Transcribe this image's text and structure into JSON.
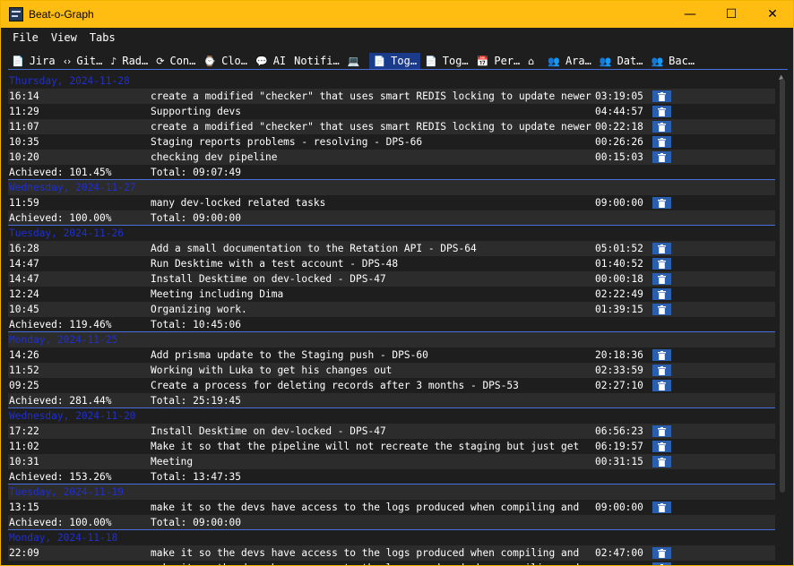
{
  "window": {
    "title": "Beat-o-Graph",
    "controls": [
      "—",
      "☐",
      "✕"
    ]
  },
  "menu": [
    "File",
    "View",
    "Tabs"
  ],
  "tabs": [
    {
      "icon": "📄",
      "label": "Jira"
    },
    {
      "icon": "‹›",
      "label": "Git…"
    },
    {
      "icon": "♪",
      "label": "Rad…"
    },
    {
      "icon": "⟳",
      "label": "Con…"
    },
    {
      "icon": "⌚",
      "label": "Clo…"
    },
    {
      "icon": "💬",
      "label": "AI"
    },
    {
      "icon": "",
      "label": "Notifi…"
    },
    {
      "icon": "💻",
      "label": ""
    },
    {
      "icon": "📄",
      "label": "Tog…",
      "active": true
    },
    {
      "icon": "📄",
      "label": "Tog…"
    },
    {
      "icon": "📅",
      "label": "Per…"
    },
    {
      "icon": "⌂",
      "label": ""
    },
    {
      "icon": "👥",
      "label": "Ara…"
    },
    {
      "icon": "👥",
      "label": "Dat…"
    },
    {
      "icon": "👥",
      "label": "Bac…"
    }
  ],
  "days": [
    {
      "header": "Thursday, 2024-11-28",
      "entries": [
        {
          "time": "16:14",
          "desc": "create a modified \"checker\" that uses smart REDIS locking to update newer",
          "dur": "03:19:05"
        },
        {
          "time": "11:29",
          "desc": "Supporting devs",
          "dur": "04:44:57"
        },
        {
          "time": "11:07",
          "desc": "create a modified \"checker\" that uses smart REDIS locking to update newer",
          "dur": "00:22:18"
        },
        {
          "time": "10:35",
          "desc": "Staging reports problems - resolving - DPS-66",
          "dur": "00:26:26"
        },
        {
          "time": "10:20",
          "desc": "checking dev pipeline",
          "dur": "00:15:03"
        }
      ],
      "achieved": "Achieved: 101.45%",
      "total": "Total: 09:07:49"
    },
    {
      "header": "Wednesday, 2024-11-27",
      "entries": [
        {
          "time": "11:59",
          "desc": "many dev-locked related tasks",
          "dur": "09:00:00"
        }
      ],
      "achieved": "Achieved: 100.00%",
      "total": "Total: 09:00:00"
    },
    {
      "header": "Tuesday, 2024-11-26",
      "entries": [
        {
          "time": "16:28",
          "desc": "Add a small documentation to the Retation API - DPS-64",
          "dur": "05:01:52"
        },
        {
          "time": "14:47",
          "desc": "Run Desktime with a test account - DPS-48",
          "dur": "01:40:52"
        },
        {
          "time": "14:47",
          "desc": "Install Desktime on dev-locked - DPS-47",
          "dur": "00:00:18"
        },
        {
          "time": "12:24",
          "desc": "Meeting including Dima",
          "dur": "02:22:49"
        },
        {
          "time": "10:45",
          "desc": "Organizing work.",
          "dur": "01:39:15"
        }
      ],
      "achieved": "Achieved: 119.46%",
      "total": "Total: 10:45:06"
    },
    {
      "header": "Monday, 2024-11-25",
      "entries": [
        {
          "time": "14:26",
          "desc": "Add prisma update to the Staging push - DPS-60",
          "dur": "20:18:36"
        },
        {
          "time": "11:52",
          "desc": "Working with Luka to get his changes out",
          "dur": "02:33:59"
        },
        {
          "time": "09:25",
          "desc": "Create a process for deleting records after 3 months - DPS-53",
          "dur": "02:27:10"
        }
      ],
      "achieved": "Achieved: 281.44%",
      "total": "Total: 25:19:45"
    },
    {
      "header": "Wednesday, 2024-11-20",
      "entries": [
        {
          "time": "17:22",
          "desc": "Install Desktime on dev-locked - DPS-47",
          "dur": "06:56:23"
        },
        {
          "time": "11:02",
          "desc": "Make it so that the pipeline will not recreate the staging but just get",
          "dur": "06:19:57"
        },
        {
          "time": "10:31",
          "desc": "Meeting",
          "dur": "00:31:15"
        }
      ],
      "achieved": "Achieved: 153.26%",
      "total": "Total: 13:47:35"
    },
    {
      "header": "Tuesday, 2024-11-19",
      "entries": [
        {
          "time": "13:15",
          "desc": "make it so the devs have access to the logs produced when compiling and",
          "dur": "09:00:00"
        }
      ],
      "achieved": "Achieved: 100.00%",
      "total": "Total: 09:00:00"
    },
    {
      "header": "Monday, 2024-11-18",
      "entries": [
        {
          "time": "22:09",
          "desc": "make it so the devs have access to the logs produced when compiling and",
          "dur": "02:47:00"
        },
        {
          "time": "",
          "desc": "make it so the devs have access to the logs produced when compiling and",
          "dur": ""
        }
      ],
      "achieved": "",
      "total": ""
    }
  ],
  "delete_icon": "trash-icon"
}
